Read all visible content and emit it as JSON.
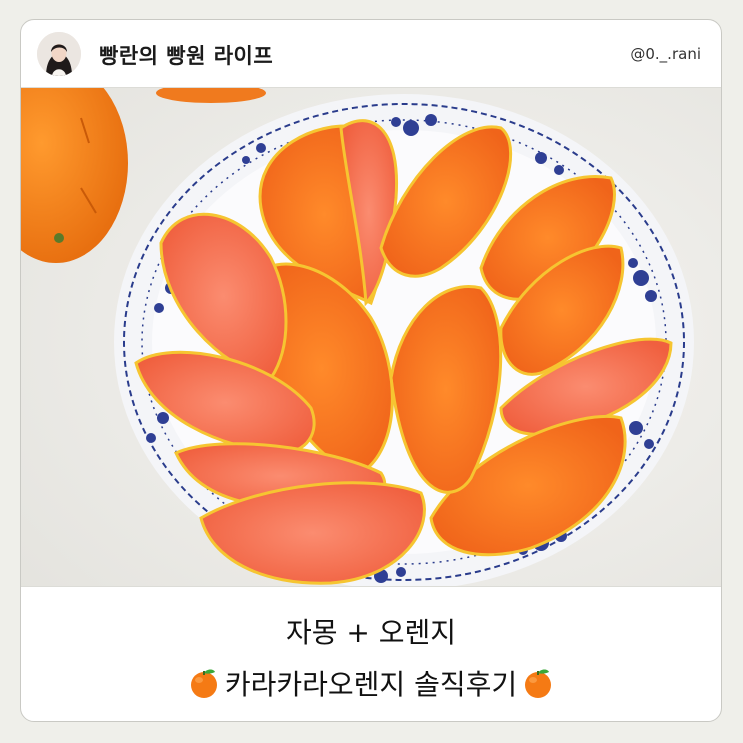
{
  "header": {
    "blog_title": "빵란의 빵원 라이프",
    "handle": "@0._.rani"
  },
  "photo": {
    "subject": "orange-slices-on-plate-photo"
  },
  "caption": {
    "line1": "자몽 + 오렌지",
    "line2": "카라카라오렌지 솔직후기"
  },
  "colors": {
    "page_bg": "#efefea",
    "card_bg": "#ffffff",
    "orange": "#f07a1e",
    "plate_pattern": "#2a3c8c"
  },
  "icons": [
    "avatar-icon",
    "tangerine-emoji-icon"
  ]
}
